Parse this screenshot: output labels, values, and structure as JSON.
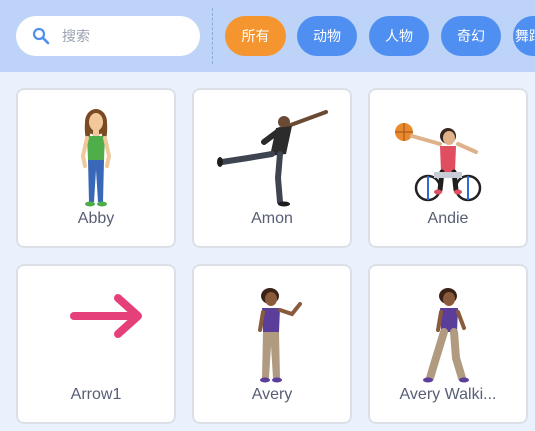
{
  "search": {
    "placeholder": "搜索",
    "icon": "search-icon"
  },
  "categories": [
    {
      "label": "所有",
      "selected": true
    },
    {
      "label": "动物",
      "selected": false
    },
    {
      "label": "人物",
      "selected": false
    },
    {
      "label": "奇幻",
      "selected": false
    },
    {
      "label": "舞蹈",
      "selected": false
    }
  ],
  "sprites": [
    {
      "name": "Abby",
      "icon": "girl-standing-icon"
    },
    {
      "name": "Amon",
      "icon": "man-balancing-icon"
    },
    {
      "name": "Andie",
      "icon": "wheelchair-basketball-icon"
    },
    {
      "name": "Arrow1",
      "icon": "arrow-right-icon"
    },
    {
      "name": "Avery",
      "icon": "girl-waving-icon"
    },
    {
      "name": "Avery Walki...",
      "icon": "girl-walking-icon"
    }
  ],
  "colors": {
    "topbar": "#bdd3f7",
    "background": "#e9f1fc",
    "chip_blue": "#4f8ff2",
    "chip_selected": "#f5952f",
    "card_border": "#dcdfe5",
    "label_text": "#575e75",
    "arrow": "#e6407b"
  }
}
